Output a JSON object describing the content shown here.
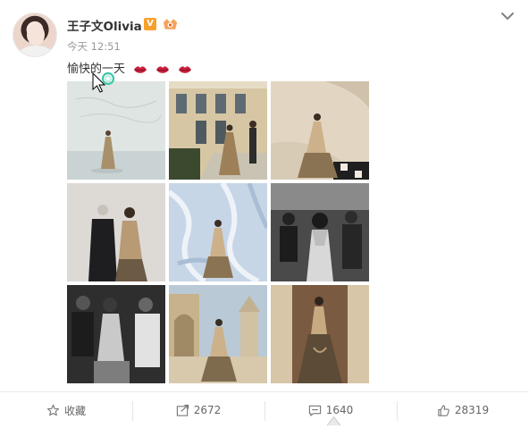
{
  "post": {
    "username": "王子文Olivia",
    "vip_badge": "V",
    "timestamp": "今天 12:51",
    "text": "愉快的一天"
  },
  "icons": {
    "emoji": "lips-emoji",
    "menu": "chevron-down-icon",
    "favorite": "star-icon",
    "repost": "repost-icon",
    "comment": "comment-icon",
    "like": "thumbs-up-icon"
  },
  "actions": {
    "favorite_label": "收藏",
    "repost_count": "2672",
    "comment_count": "1640",
    "like_count": "28319"
  },
  "colors": {
    "vip": "#f7a02e",
    "lips": "#c81f3c",
    "text": "#333333",
    "muted": "#999999"
  }
}
